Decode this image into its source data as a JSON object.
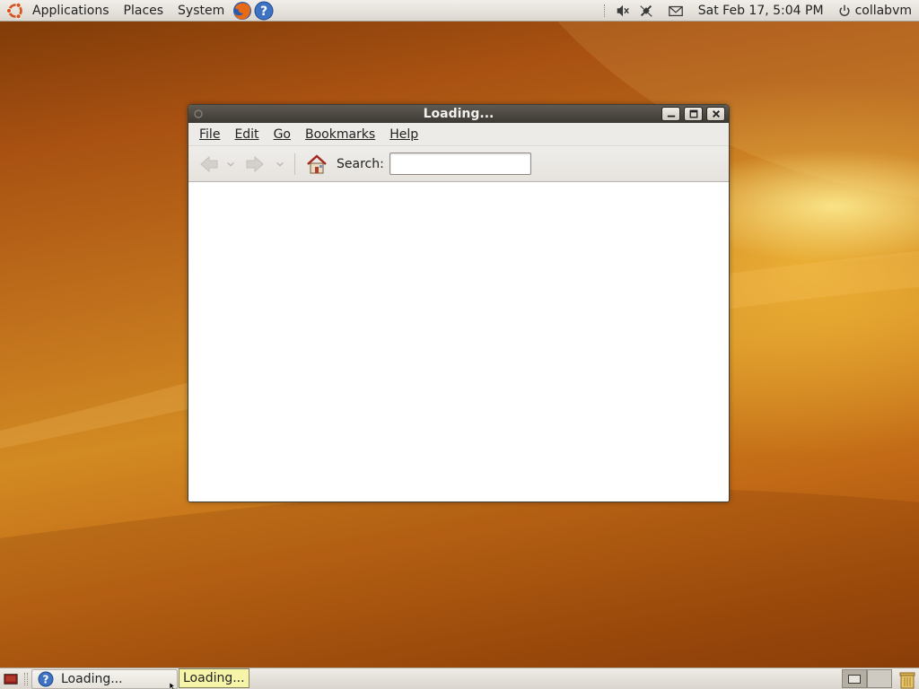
{
  "top_panel": {
    "menus": [
      "Applications",
      "Places",
      "System"
    ],
    "clock": "Sat Feb 17,  5:04 PM",
    "user": "collabvm",
    "icons": [
      "ubuntu-logo",
      "firefox-icon",
      "help-icon",
      "volume-icon",
      "network-icon",
      "mail-icon",
      "power-icon"
    ]
  },
  "window": {
    "title": "Loading...",
    "menus": [
      {
        "label": "File"
      },
      {
        "label": "Edit"
      },
      {
        "label": "Go"
      },
      {
        "label": "Bookmarks"
      },
      {
        "label": "Help"
      }
    ],
    "toolbar": {
      "search_label": "Search:",
      "search_value": ""
    }
  },
  "bottom_panel": {
    "task_label": "Loading...",
    "tooltip": "Loading...",
    "workspaces": 2
  },
  "colors": {
    "panel": "#dcd7cf",
    "titlebar": "#3c3833",
    "wallpaper": "#c0701c",
    "tooltip": "#f5f4a8"
  }
}
